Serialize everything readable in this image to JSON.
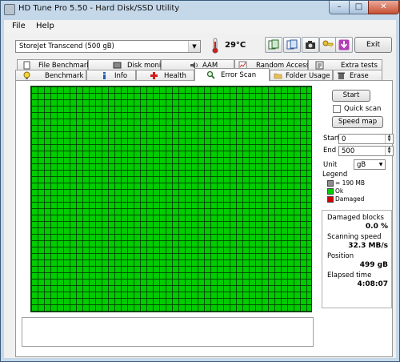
{
  "window": {
    "title": "HD Tune Pro 5.50 - Hard Disk/SSD Utility",
    "min_glyph": "–",
    "max_glyph": "□",
    "close_glyph": "✕"
  },
  "menu": {
    "items": [
      "File",
      "Help"
    ]
  },
  "toolbar": {
    "drive": "StoreJet Transcend  (500 gB)",
    "dropdown_glyph": "▼",
    "temperature": "29°C",
    "icons": [
      "copy-info-icon",
      "copy-screenshot-icon",
      "camera-icon",
      "key-icon",
      "download-icon"
    ],
    "exit_label": "Exit"
  },
  "tabs": {
    "row_back": [
      "File Benchmark",
      "Disk monitor",
      "AAM",
      "Random Access",
      "Extra tests"
    ],
    "row_front": [
      "Benchmark",
      "Info",
      "Health",
      "Error Scan",
      "Folder Usage",
      "Erase"
    ],
    "active": "Error Scan"
  },
  "error_scan": {
    "start_label": "Start",
    "quick_scan_label": "Quick scan",
    "quick_scan_checked": false,
    "speed_map_label": "Speed map",
    "start_field_label": "Start",
    "start_value": "0",
    "end_field_label": "End",
    "end_value": "500",
    "unit_label": "Unit",
    "unit_value": "gB",
    "spin_up": "▲",
    "spin_down": "▼",
    "legend": {
      "title": "Legend",
      "items": [
        {
          "label": "= 190 MB",
          "color": "#8c8c8c"
        },
        {
          "label": "Ok",
          "color": "#00cc00"
        },
        {
          "label": "Damaged",
          "color": "#cc0000"
        }
      ]
    },
    "stats": {
      "damaged_label": "Damaged blocks",
      "damaged_value": "0.0 %",
      "speed_label": "Scanning speed",
      "speed_value": "32.3 MB/s",
      "position_label": "Position",
      "position_value": "499 gB",
      "elapsed_label": "Elapsed time",
      "elapsed_value": "4:08:07"
    },
    "block_map": {
      "status": "ok",
      "color": "#00cc00",
      "damaged_fraction": 0.0
    }
  },
  "colors": {
    "ok_green": "#00cc00",
    "damaged_red": "#cc0000",
    "window_frame": "#c4d8ea",
    "desktop": "#6f9bc4"
  }
}
